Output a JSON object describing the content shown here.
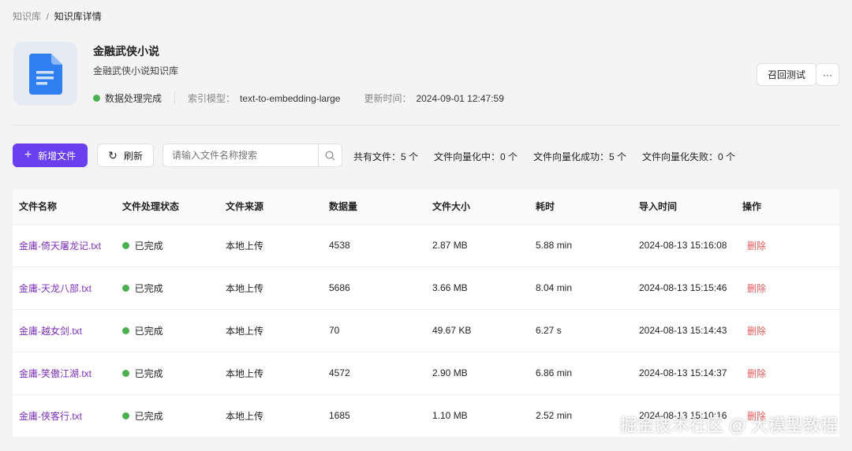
{
  "breadcrumb": {
    "root": "知识库",
    "current": "知识库详情"
  },
  "kb": {
    "title": "金融武侠小说",
    "description": "金融武侠小说知识库",
    "status": "数据处理完成",
    "model_label": "索引模型：",
    "model": "text-to-embedding-large",
    "updated_label": "更新时间：",
    "updated": "2024-09-01 12:47:59"
  },
  "actions": {
    "recall_test": "召回测试",
    "more": "···"
  },
  "toolbar": {
    "add_file": "新增文件",
    "refresh": "刷新",
    "search_placeholder": "请输入文件名称搜索"
  },
  "stats": [
    "共有文件：5 个",
    "文件向量化中：0 个",
    "文件向量化成功：5 个",
    "文件向量化失败：0 个"
  ],
  "table": {
    "headers": [
      "文件名称",
      "文件处理状态",
      "文件来源",
      "数据量",
      "文件大小",
      "耗时",
      "导入时间",
      "操作"
    ],
    "rows": [
      {
        "name": "金庸-倚天屠龙记.txt",
        "status": "已完成",
        "source": "本地上传",
        "count": "4538",
        "size": "2.87 MB",
        "time": "5.88 min",
        "imported": "2024-08-13 15:16:08",
        "action": "删除"
      },
      {
        "name": "金庸-天龙八部.txt",
        "status": "已完成",
        "source": "本地上传",
        "count": "5686",
        "size": "3.66 MB",
        "time": "8.04 min",
        "imported": "2024-08-13 15:15:46",
        "action": "删除"
      },
      {
        "name": "金庸-越女剑.txt",
        "status": "已完成",
        "source": "本地上传",
        "count": "70",
        "size": "49.67 KB",
        "time": "6.27 s",
        "imported": "2024-08-13 15:14:43",
        "action": "删除"
      },
      {
        "name": "金庸-笑傲江湖.txt",
        "status": "已完成",
        "source": "本地上传",
        "count": "4572",
        "size": "2.90 MB",
        "time": "6.86 min",
        "imported": "2024-08-13 15:14:37",
        "action": "删除"
      },
      {
        "name": "金庸-侠客行.txt",
        "status": "已完成",
        "source": "本地上传",
        "count": "1685",
        "size": "1.10 MB",
        "time": "2.52 min",
        "imported": "2024-08-13 15:10:16",
        "action": "删除"
      }
    ]
  },
  "watermark": "掘金技术社区 @ 大模型教程"
}
